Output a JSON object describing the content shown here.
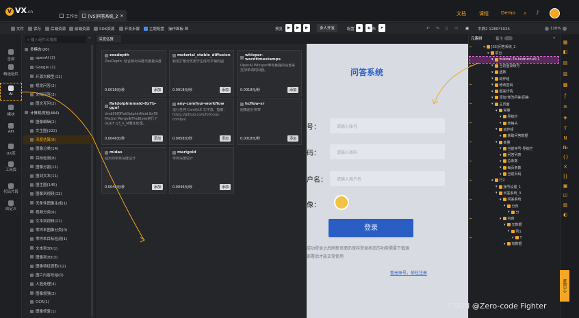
{
  "app": {
    "logo": "VX",
    "logo_suffix": ".cn",
    "tabs": [
      "工作台",
      "[VS]问答系统_2"
    ],
    "links": [
      "文档",
      "课程",
      "Demo"
    ]
  },
  "toolbar": {
    "items": [
      "文件",
      "保存",
      "后端资源",
      "前端资源",
      "SDK资源",
      "开发步骤",
      "主题配置",
      "操作面板"
    ],
    "run_label": "预览",
    "multi_dev": "多人开发",
    "config": "配置",
    "publish": "发布",
    "device": "中屏2 1280*1024",
    "zoom": "120%"
  },
  "rail": [
    "全部",
    "精选组件",
    "AI",
    "模块",
    "API",
    "UX库",
    "工具库",
    "代码片段",
    "自定义"
  ],
  "search": {
    "placeholder": "输入组件名搜索"
  },
  "components": [
    {
      "label": "多模态(20)",
      "group": true
    },
    {
      "label": "openAI (3)"
    },
    {
      "label": "Google (1)"
    },
    {
      "label": "开源大模型(11)"
    },
    {
      "label": "视觉问答(2)"
    },
    {
      "label": "文档问答(2)"
    },
    {
      "label": "图文互问(2)"
    },
    {
      "label": "计算机视觉(464)",
      "group": true
    },
    {
      "label": "图像编辑(2)"
    },
    {
      "label": "文生图(222)"
    },
    {
      "label": "深度估算(8)",
      "selected": true
    },
    {
      "label": "图像分类(14)"
    },
    {
      "label": "目标检测(8)"
    },
    {
      "label": "图像分割(11)"
    },
    {
      "label": "图到文本(11)"
    },
    {
      "label": "图生图(145)"
    },
    {
      "label": "图像到视频(12)"
    },
    {
      "label": "无条件图像生成(1)"
    },
    {
      "label": "视频分类(6)"
    },
    {
      "label": "文本到视频(21)"
    },
    {
      "label": "零样本图像分类(0)"
    },
    {
      "label": "零样本目标检测(1)"
    },
    {
      "label": "文本到3D(1)"
    },
    {
      "label": "图像到3D(3)"
    },
    {
      "label": "图像特征提取(12)"
    },
    {
      "label": "图片内容总结(0)"
    },
    {
      "label": "人脸处理(4)"
    },
    {
      "label": "图像增强(2)"
    },
    {
      "label": "OCR(1)"
    },
    {
      "label": "图像修复(1)"
    }
  ],
  "category_tab": "深度估算",
  "cards": [
    {
      "title": "zoedepth",
      "desc": "ZoeDepth: 结合相对深度与度量深度",
      "price": "0.0018元/秒",
      "add": "添加"
    },
    {
      "title": "material_stable_diffusion",
      "desc": "稳定扩散分支用于生成可平铺的图",
      "price": "0.0018元/秒",
      "add": "添加"
    },
    {
      "title": "whisper-wordtimestamps",
      "desc": "OpenAI Whisper带有暴露的设置来支持单词时间戳。",
      "price": "0.0018元/秒",
      "add": "添加"
    },
    {
      "title": "flatdolphinmaid-8x7b-gguf",
      "desc": "Undi95的FlatDolphinMaid 8x7B Mixtral Merge由TheBloke进行了GGUF Q3_K_M量化处理。",
      "price": "0.0046元/秒",
      "add": "添加"
    },
    {
      "title": "any-comfyui-workflow",
      "desc": "运行任何 ComfyUI 工作流。指南: https://github.com/fofr/cog-comfyui",
      "price": "0.0058元/秒",
      "add": "添加"
    },
    {
      "title": "hcflow-sr",
      "desc": "图像超分辨率",
      "price": "0.0018元/秒",
      "add": "添加"
    },
    {
      "title": "midas",
      "desc": "强大的单目深度估计",
      "price": "0.0046元/秒",
      "add": "添加"
    },
    {
      "title": "marigold",
      "desc": "单目深度估计",
      "price": "0.0046元/秒",
      "add": "添加"
    }
  ],
  "form": {
    "title": "问答系统",
    "labels": [
      "号：",
      "码：",
      "户名：",
      "像："
    ],
    "placeholders": [
      "请输入账号",
      "请输入密码",
      "请输入用户名"
    ],
    "login": "登录",
    "note1": "成功登录之后刷新页面仍保持登录状态的功能需要下载源",
    "note2": "部署后才能正常使用",
    "register": "暂无账号，前往注册"
  },
  "right_tabs": [
    "元素树",
    "备注"
  ],
  "tree": [
    {
      "label": "[SS]问答系统_2",
      "indent": 2
    },
    {
      "label": "前台",
      "indent": 3
    },
    {
      "label": "mistral-7b-instruct-v0.1",
      "indent": 4,
      "hl": true
    },
    {
      "label": "当前登录账号",
      "indent": 4
    },
    {
      "label": "函数",
      "indent": 4
    },
    {
      "label": "动作组",
      "indent": 4
    },
    {
      "label": "修改密码",
      "indent": 4
    },
    {
      "label": "回答详情",
      "indent": 4
    },
    {
      "label": "添加/修改问答/回答",
      "indent": 4
    },
    {
      "label": "主页面",
      "indent": 4
    },
    {
      "label": "常量",
      "indent": 5
    },
    {
      "label": "导航栏",
      "indent": 6
    },
    {
      "label": "表格头",
      "indent": 6
    },
    {
      "label": "动作组",
      "indent": 5
    },
    {
      "label": "获取问答数据",
      "indent": 6
    },
    {
      "label": "变量",
      "indent": 5
    },
    {
      "label": "当前序号-导航栏",
      "indent": 6
    },
    {
      "label": "问答列表",
      "indent": 6
    },
    {
      "label": "总条数",
      "indent": 6
    },
    {
      "label": "每页条数",
      "indent": 6
    },
    {
      "label": "当前页码",
      "indent": 6
    },
    {
      "label": "行2",
      "indent": 4
    },
    {
      "label": "账号设置_1",
      "indent": 5
    },
    {
      "label": "问答系统_0",
      "indent": 5
    },
    {
      "label": "问答系统",
      "indent": 6
    },
    {
      "label": "分页",
      "indent": 7
    },
    {
      "label": "分",
      "indent": 8
    },
    {
      "label": "内容",
      "indent": 6
    },
    {
      "label": "无数据",
      "indent": 7
    },
    {
      "label": "列1",
      "indent": 8
    },
    {
      "label": "T",
      "indent": 9
    },
    {
      "label": "有数据",
      "indent": 7
    }
  ],
  "helper": "帮助中心",
  "watermark": "CSDN @Zero-code Fighter"
}
